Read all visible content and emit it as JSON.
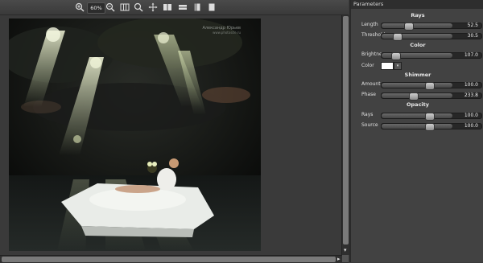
{
  "toolbar": {
    "zoom_level": "60%",
    "buttons": [
      "zoom-in-icon",
      "zoom-out-icon",
      "fit-icon",
      "magnify-icon",
      "pan-icon",
      "split-icon",
      "before-after-icon",
      "panel-left-icon",
      "panel-right-icon"
    ]
  },
  "canvas": {
    "watermark_line1": "Александр Юрьев",
    "watermark_line2": "www.photosite.ru"
  },
  "panel": {
    "header": "Parameters",
    "sections": {
      "rays": {
        "title": "Rays",
        "length_label": "Length",
        "length_value": "52.5",
        "length_fraction": 0.36,
        "threshold_label": "Threshold",
        "threshold_value": "30.5",
        "threshold_fraction": 0.18
      },
      "color": {
        "title": "Color",
        "brightness_label": "Brightness",
        "brightness_value": "107.0",
        "brightness_fraction": 0.16,
        "color_label": "Color",
        "color_value": "#ffffff"
      },
      "shimmer": {
        "title": "Shimmer",
        "amount_label": "Amount",
        "amount_value": "100.0",
        "amount_fraction": 0.69,
        "phase_label": "Phase",
        "phase_value": "233.8",
        "phase_fraction": 0.44
      },
      "opacity": {
        "title": "Opacity",
        "rays_label": "Rays",
        "rays_value": "100.0",
        "rays_fraction": 0.69,
        "source_label": "Source",
        "source_value": "100.0",
        "source_fraction": 0.69
      }
    }
  }
}
